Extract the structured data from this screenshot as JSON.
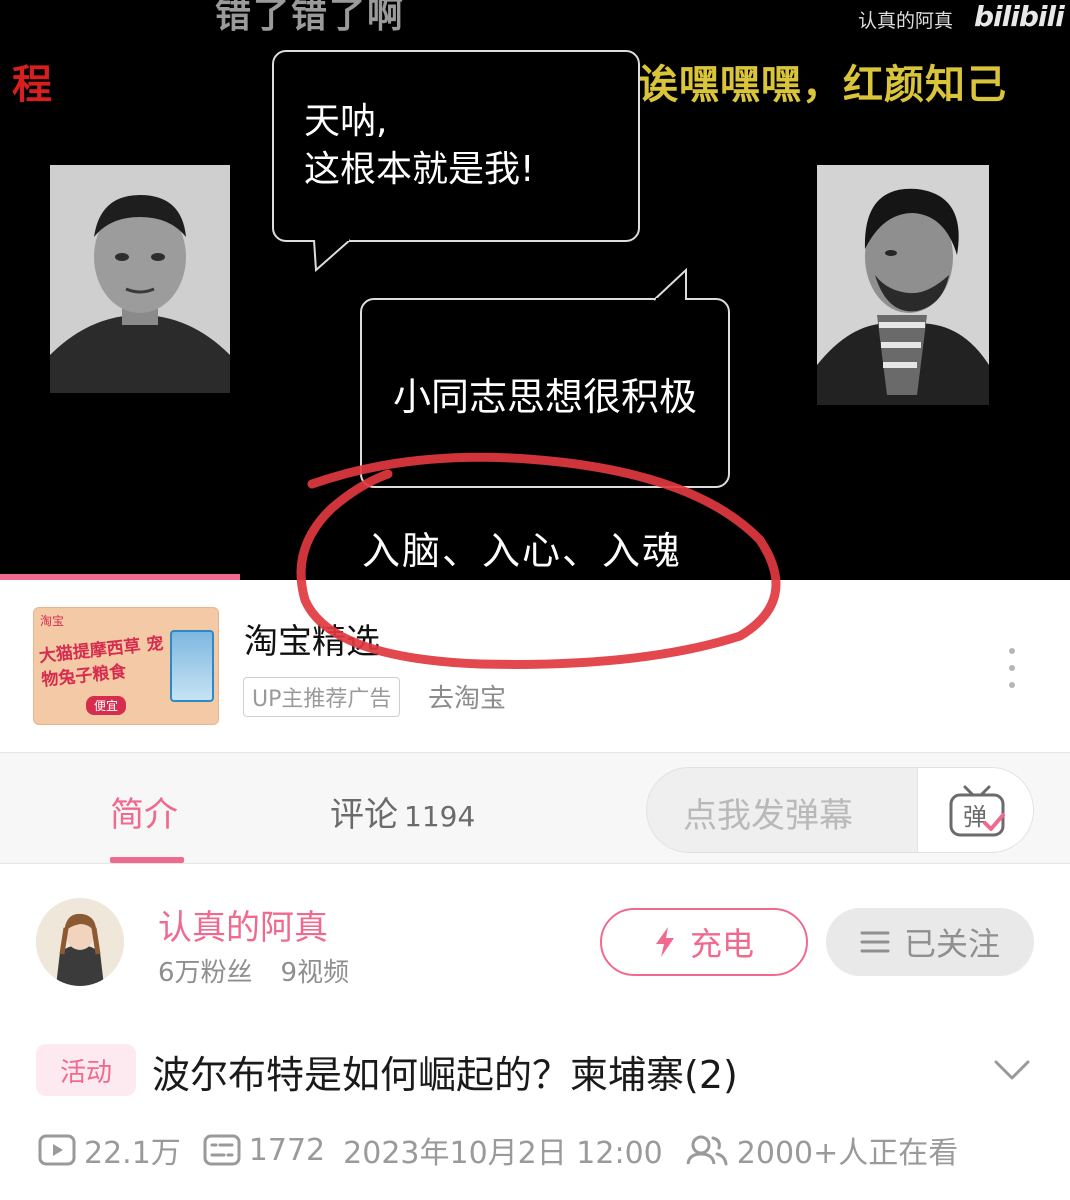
{
  "video": {
    "subtitle_top": "错了错了啊",
    "subtitle_left": "程",
    "subtitle_right": "马西埃:诶嘿嘿嘿，红颜知己",
    "watermark_user": "认真的阿真",
    "watermark_logo": "bilibili",
    "bubble1_line1": "天呐,",
    "bubble1_line2": "这根本就是我!",
    "bubble2_text": "小同志思想很积极",
    "subtitle_bottom": "入脑、入心、入魂",
    "progress_fraction": 0.224
  },
  "ad": {
    "thumb_label": "淘宝",
    "thumb_text": "大猫提摩西草 宠物兔子粮食",
    "thumb_button": "便宜",
    "title": "淘宝精选",
    "tag": "UP主推荐广告",
    "link": "去淘宝"
  },
  "tabs": {
    "intro": "简介",
    "comments_label": "评论",
    "comments_count": "1194",
    "danmaku_placeholder": "点我发弹幕",
    "danmaku_icon_text": "弹"
  },
  "uploader": {
    "name": "认真的阿真",
    "fans": "6万粉丝",
    "videos": "9视频",
    "charge_label": "充电",
    "follow_label": "已关注"
  },
  "video_info": {
    "badge": "活动",
    "title": "波尔布特是如何崛起的？柬埔寨(2)",
    "views": "22.1万",
    "danmaku_count": "1772",
    "datetime": "2023年10月2日 12:00",
    "watching": "2000+人正在看"
  },
  "colors": {
    "accent": "#f06a8f",
    "annotation": "#e0383e",
    "subtitle_yellow": "#d9c43a",
    "subtitle_red": "#d81f1f"
  }
}
